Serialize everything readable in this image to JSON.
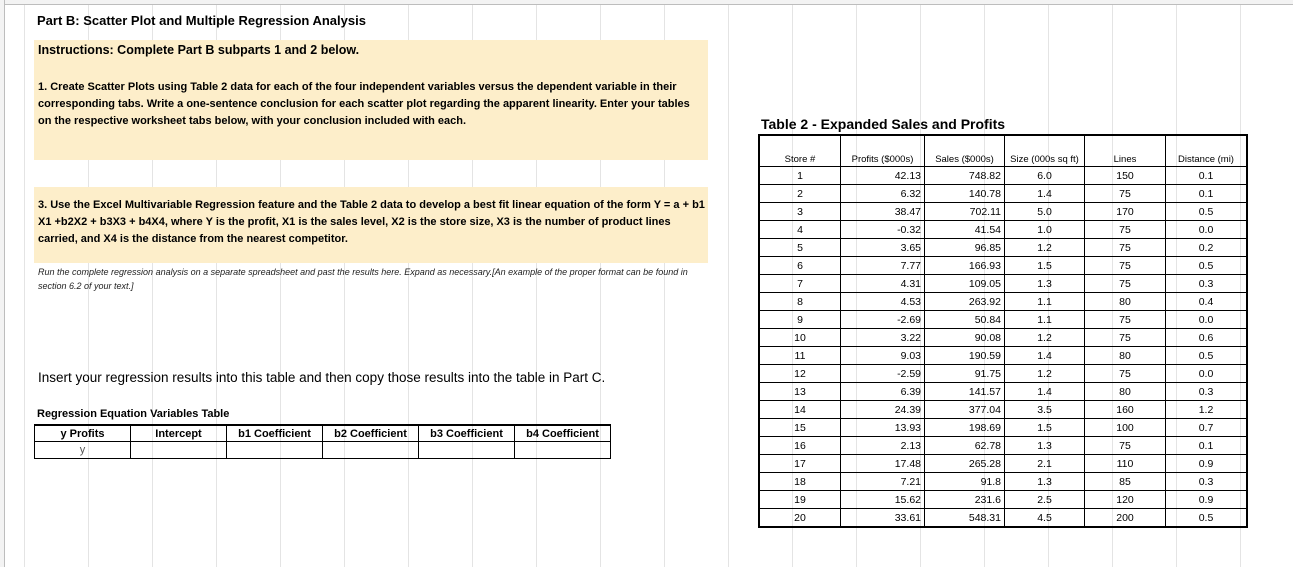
{
  "part_title": "Part B: Scatter Plot and Multiple Regression Analysis",
  "instructions_heading": "Instructions: Complete Part B subparts 1 and 2 below.",
  "instruction_1": "1. Create Scatter Plots using Table 2 data for each of the four independent variables versus the dependent variable in their corresponding tabs. Write a one-sentence conclusion for each scatter plot regarding the apparent linearity.  Enter your tables on the respective worksheet tabs below, with your conclusion included with each.",
  "instruction_3": "3. Use the Excel Multivariable Regression feature and the Table 2 data to develop a best fit linear equation of the form Y = a + b1 X1 +b2X2 + b3X3 + b4X4, where Y is the profit, X1 is the sales level, X2 is the store size, X3 is the number of product lines carried, and X4 is the distance from the nearest competitor.",
  "note": "Run the complete regression analysis on a separate spreadsheet and past the results here. Expand as necessary.[An example of the proper format can be found in section 6.2 of your text.]",
  "insert_text": "Insert your regression results into this table and then copy those results into the table in Part C.",
  "regression_table": {
    "title": "Regression Equation Variables Table",
    "headers": [
      "y Profits",
      "Intercept",
      "b1 Coefficient",
      "b2 Coefficient",
      "b3 Coefficient",
      "b4 Coefficient"
    ],
    "row": [
      "y",
      "",
      "",
      "",
      "",
      ""
    ]
  },
  "table2": {
    "title": "Table 2 - Expanded Sales and Profits",
    "headers": [
      "Store #",
      "Profits ($000s)",
      "Sales ($000s)",
      "Size (000s sq ft)",
      "Lines",
      "Distance (mi)"
    ],
    "rows": [
      [
        "1",
        "42.13",
        "748.82",
        "6.0",
        "150",
        "0.1"
      ],
      [
        "2",
        "6.32",
        "140.78",
        "1.4",
        "75",
        "0.1"
      ],
      [
        "3",
        "38.47",
        "702.11",
        "5.0",
        "170",
        "0.5"
      ],
      [
        "4",
        "-0.32",
        "41.54",
        "1.0",
        "75",
        "0.0"
      ],
      [
        "5",
        "3.65",
        "96.85",
        "1.2",
        "75",
        "0.2"
      ],
      [
        "6",
        "7.77",
        "166.93",
        "1.5",
        "75",
        "0.5"
      ],
      [
        "7",
        "4.31",
        "109.05",
        "1.3",
        "75",
        "0.3"
      ],
      [
        "8",
        "4.53",
        "263.92",
        "1.1",
        "80",
        "0.4"
      ],
      [
        "9",
        "-2.69",
        "50.84",
        "1.1",
        "75",
        "0.0"
      ],
      [
        "10",
        "3.22",
        "90.08",
        "1.2",
        "75",
        "0.6"
      ],
      [
        "11",
        "9.03",
        "190.59",
        "1.4",
        "80",
        "0.5"
      ],
      [
        "12",
        "-2.59",
        "91.75",
        "1.2",
        "75",
        "0.0"
      ],
      [
        "13",
        "6.39",
        "141.57",
        "1.4",
        "80",
        "0.3"
      ],
      [
        "14",
        "24.39",
        "377.04",
        "3.5",
        "160",
        "1.2"
      ],
      [
        "15",
        "13.93",
        "198.69",
        "1.5",
        "100",
        "0.7"
      ],
      [
        "16",
        "2.13",
        "62.78",
        "1.3",
        "75",
        "0.1"
      ],
      [
        "17",
        "17.48",
        "265.28",
        "2.1",
        "110",
        "0.9"
      ],
      [
        "18",
        "7.21",
        "91.8",
        "1.3",
        "85",
        "0.3"
      ],
      [
        "19",
        "15.62",
        "231.6",
        "2.5",
        "120",
        "0.9"
      ],
      [
        "20",
        "33.61",
        "548.31",
        "4.5",
        "200",
        "0.5"
      ]
    ]
  }
}
